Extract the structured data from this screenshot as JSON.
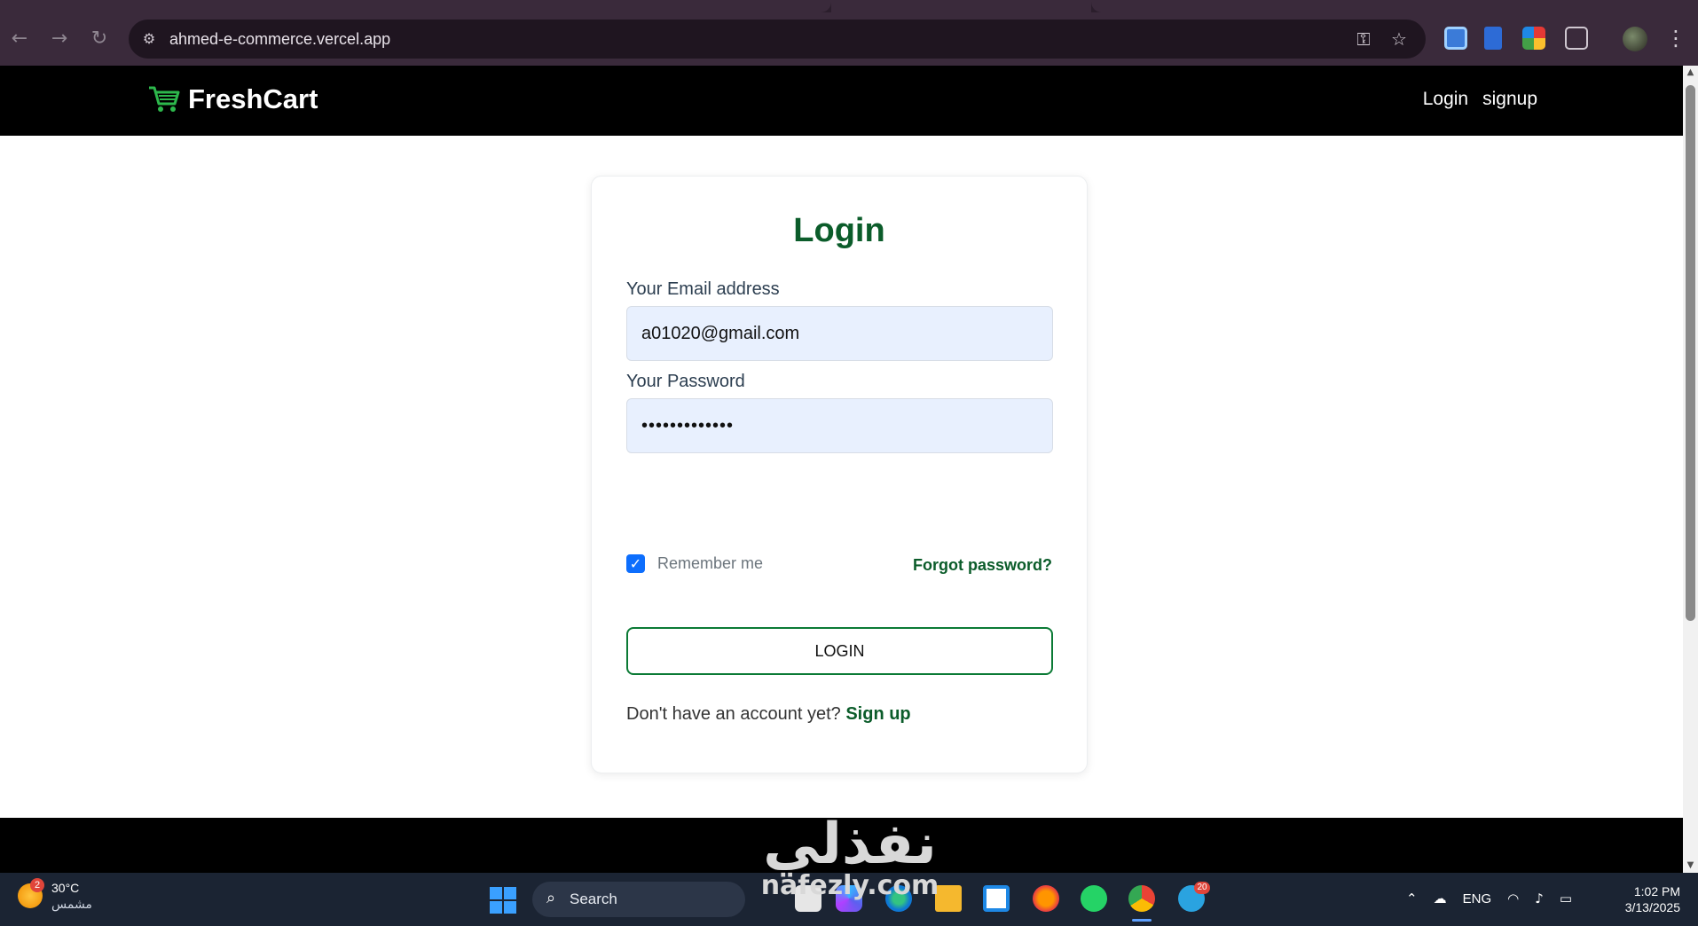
{
  "browser": {
    "url": "ahmed-e-commerce.vercel.app",
    "icons": {
      "back": "arrow-left-icon",
      "forward": "arrow-right-icon",
      "reload": "reload-icon",
      "site": "site-settings-icon",
      "key": "key-icon",
      "star": "star-icon",
      "menu": "more-vert-icon"
    }
  },
  "site": {
    "brand": "FreshCart",
    "nav": {
      "login": "Login",
      "signup": "signup"
    }
  },
  "login_form": {
    "title": "Login",
    "email_label": "Your Email address",
    "email_value": "a01020@gmail.com",
    "password_label": "Your Password",
    "password_value": "•••••••••••••",
    "remember_label": "Remember me",
    "remember_checked": true,
    "forgot_label": "Forgot password?",
    "submit_label": "LOGIN",
    "no_account_text": "Don't have an account yet?",
    "signup_link": "Sign up"
  },
  "watermark": {
    "arabic": "نفذلي",
    "latin": "nafezly.com"
  },
  "taskbar": {
    "weather_badge": "2",
    "temperature": "30°C",
    "weather_desc": "مشمس",
    "search_label": "Search",
    "telegram_badge": "20",
    "language": "ENG",
    "time": "1:02 PM",
    "date": "3/13/2025"
  },
  "colors": {
    "brand_green": "#0b5c2a",
    "cart_green": "#2db84c",
    "input_bg": "#e8f0fe",
    "checkbox_blue": "#0d6efd",
    "navbar_bg": "#000000"
  }
}
